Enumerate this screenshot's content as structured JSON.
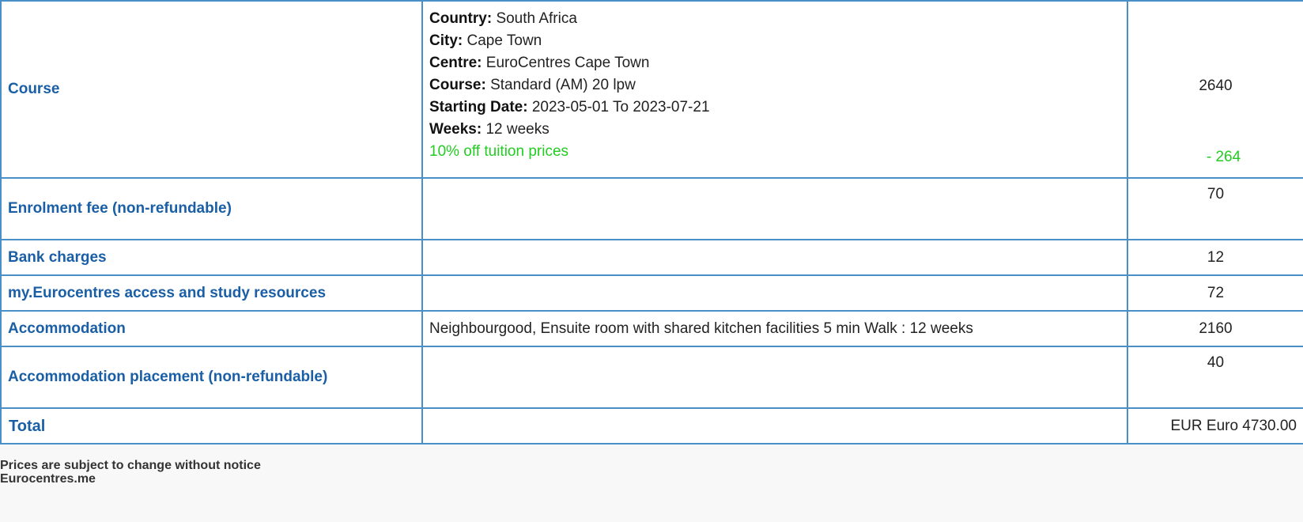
{
  "rows": {
    "course": {
      "label": "Course",
      "details": [
        {
          "key": "Country:",
          "value": "South Africa"
        },
        {
          "key": "City:",
          "value": "Cape Town"
        },
        {
          "key": "Centre:",
          "value": "EuroCentres Cape Town"
        },
        {
          "key": "Course:",
          "value": "Standard (AM) 20 lpw"
        },
        {
          "key": "Starting Date:",
          "value": "2023-05-01 To 2023-07-21"
        },
        {
          "key": "Weeks:",
          "value": "12 weeks"
        }
      ],
      "discount_text": "10% off tuition prices",
      "amount": "2640",
      "discount_amount": "- 264"
    },
    "enrolment": {
      "label": "Enrolment fee (non-refundable)",
      "amount": "70"
    },
    "bank": {
      "label": "Bank charges",
      "amount": "12"
    },
    "my_eurocentres": {
      "label": "my.Eurocentres access and study resources",
      "amount": "72"
    },
    "accommodation": {
      "label": "Accommodation",
      "desc": "Neighbourgood, Ensuite room with shared kitchen facilities 5 min Walk : 12 weeks",
      "amount": "2160"
    },
    "placement": {
      "label": "Accommodation placement (non-refundable)",
      "amount": "40"
    },
    "total": {
      "label": "Total",
      "amount": "EUR Euro 4730.00"
    }
  },
  "footer": {
    "notice": "Prices are subject to change without notice",
    "site": "Eurocentres.me"
  },
  "colors": {
    "label_blue": "#1a5fa6",
    "border_blue": "#4a90c8",
    "discount_green": "#22cc22"
  }
}
